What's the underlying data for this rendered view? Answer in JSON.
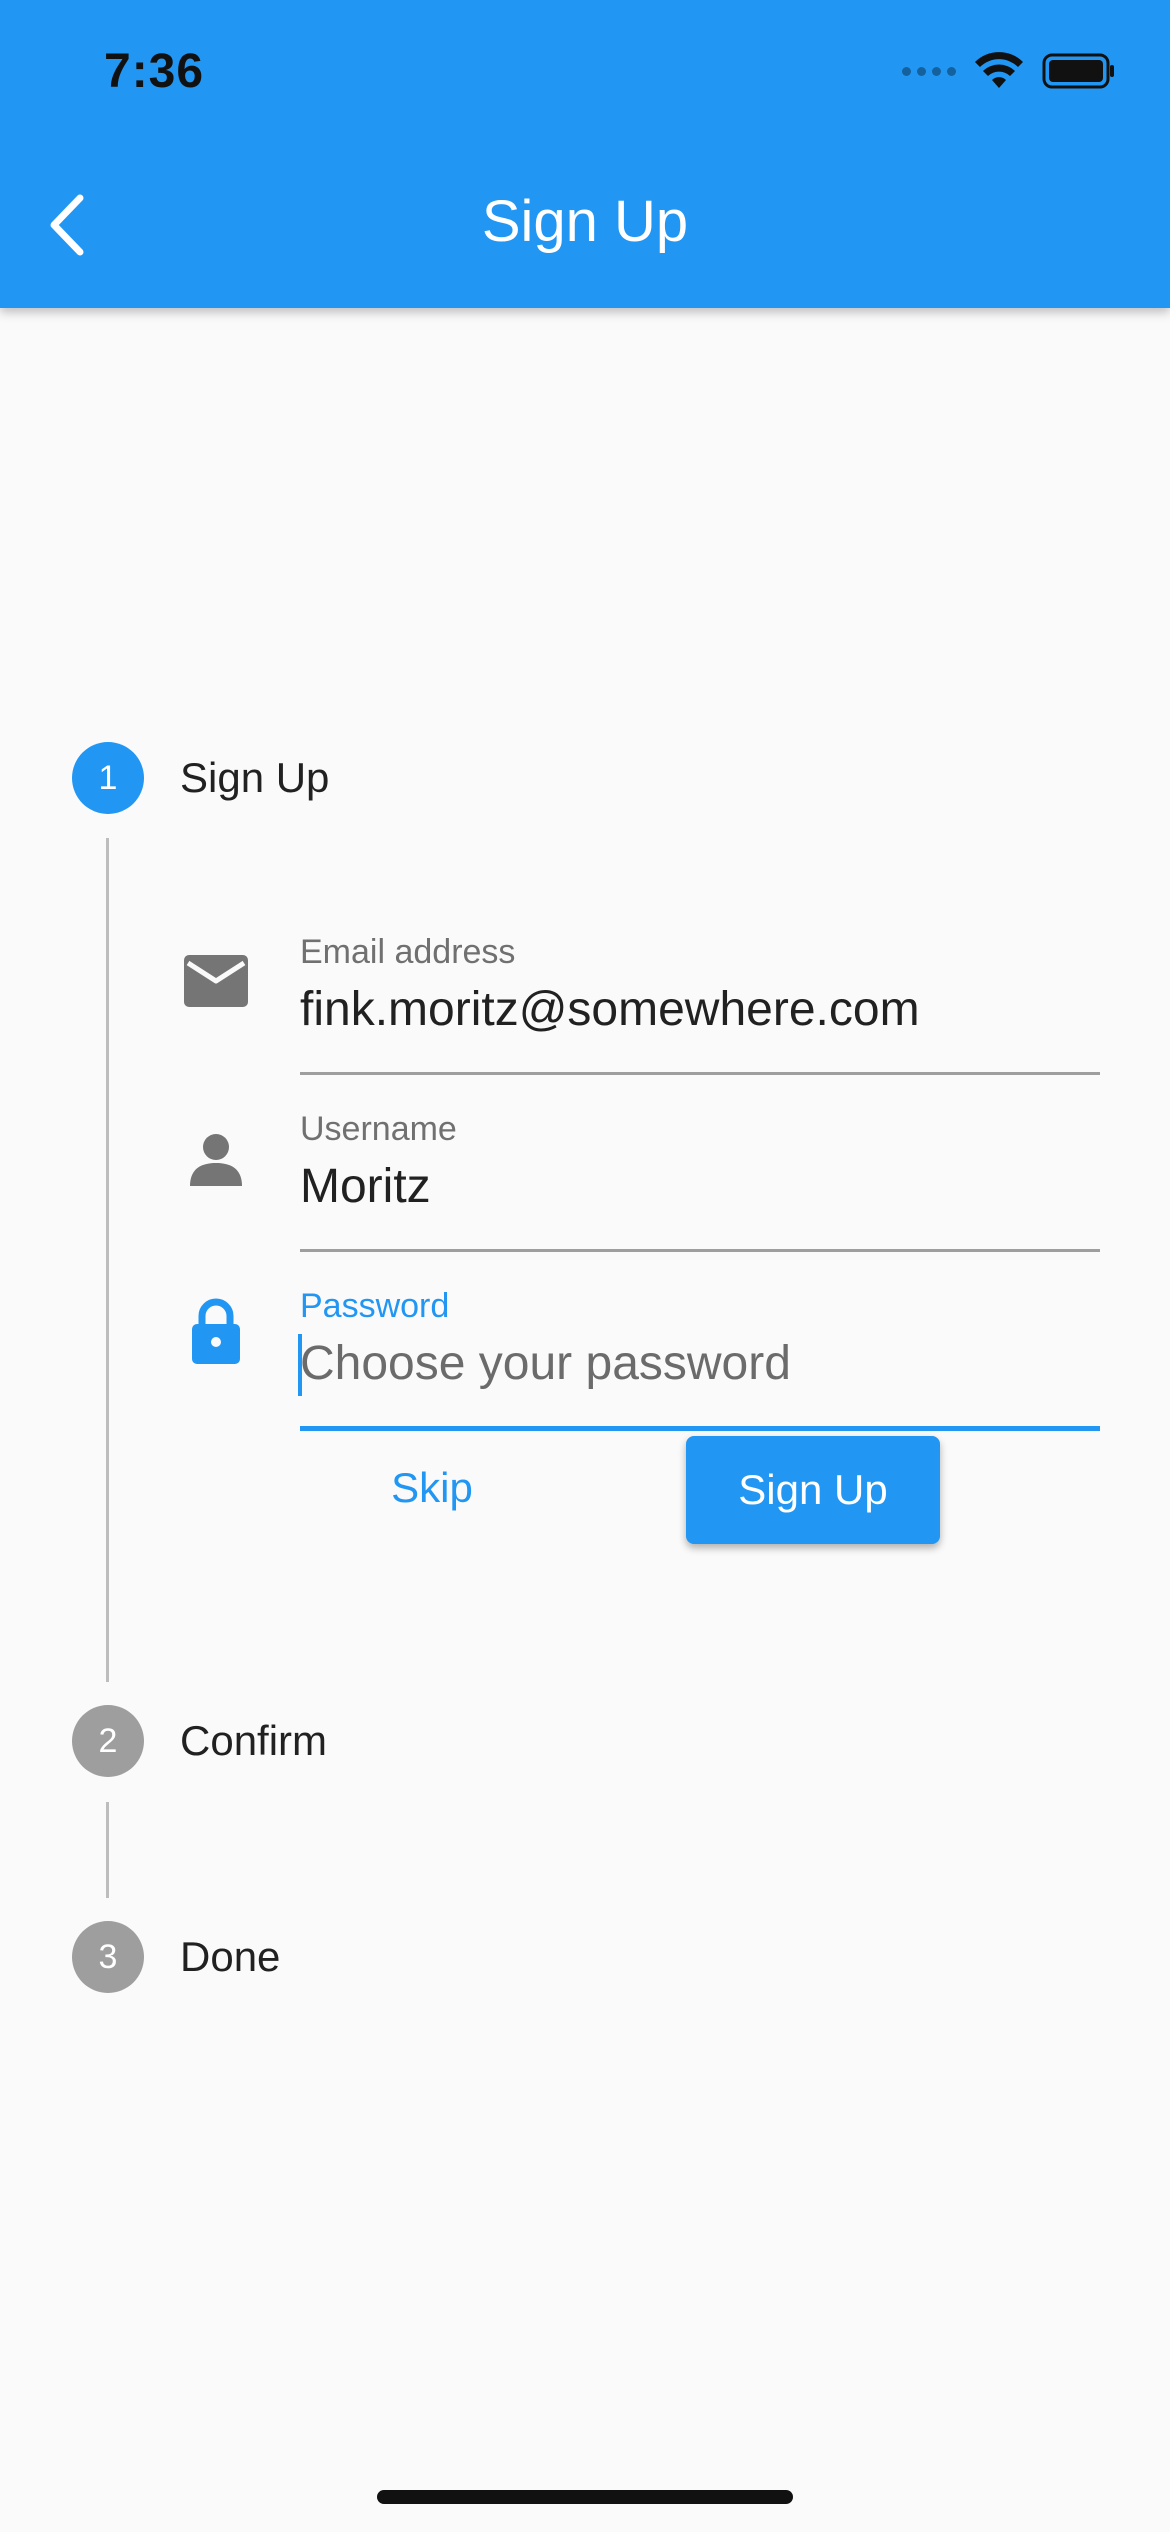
{
  "status_bar": {
    "time": "7:36"
  },
  "app_bar": {
    "title": "Sign Up",
    "back_icon": "chevron-left-icon",
    "color": "#2196f3"
  },
  "stepper": {
    "steps": [
      {
        "number": "1",
        "label": "Sign Up",
        "state": "active"
      },
      {
        "number": "2",
        "label": "Confirm",
        "state": "inactive"
      },
      {
        "number": "3",
        "label": "Done",
        "state": "inactive"
      }
    ]
  },
  "form": {
    "email": {
      "label": "Email address",
      "value": "fink.moritz@somewhere.com",
      "icon": "email-icon"
    },
    "username": {
      "label": "Username",
      "value": "Moritz",
      "icon": "person-icon"
    },
    "password": {
      "label": "Password",
      "placeholder": "Choose your password",
      "icon": "lock-icon",
      "focused": true
    }
  },
  "actions": {
    "skip_label": "Skip",
    "signup_label": "Sign Up"
  },
  "colors": {
    "accent": "#2196f3",
    "inactive": "#9e9e9e",
    "background": "#fafafa"
  }
}
